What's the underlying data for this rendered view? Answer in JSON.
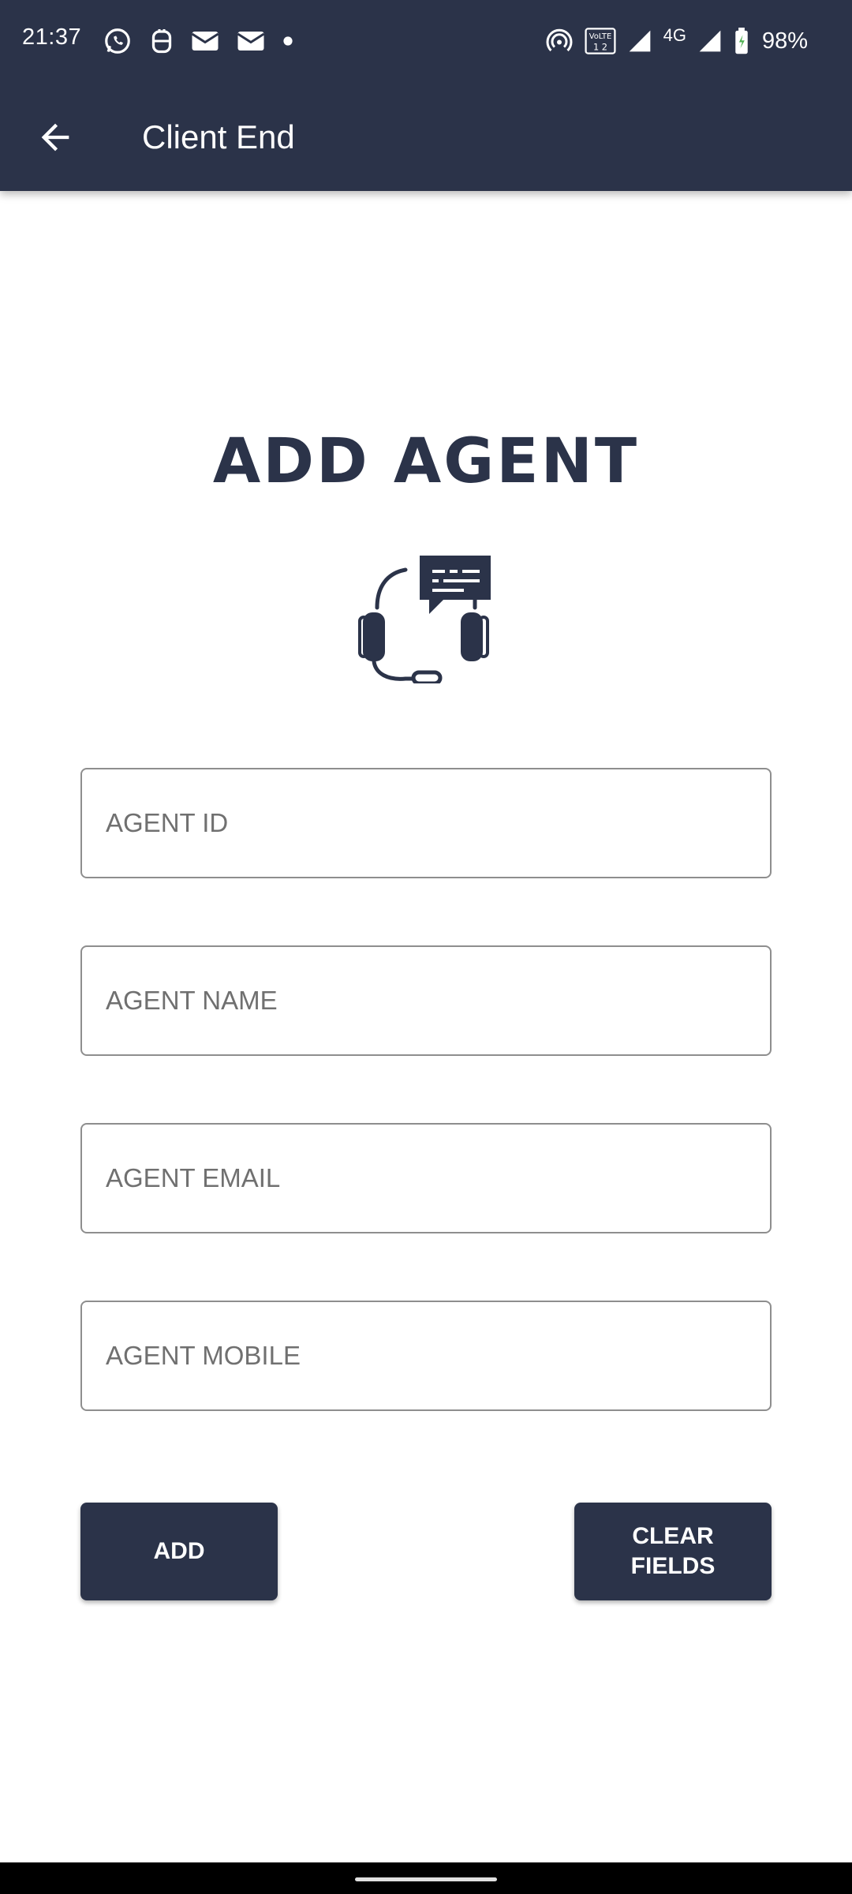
{
  "status_bar": {
    "time": "21:37",
    "battery": "98%",
    "network": "4G",
    "left_icons": [
      "whatsapp-icon",
      "notification-app-icon",
      "gmail-icon",
      "gmail-icon",
      "dot-icon"
    ],
    "right_icons": [
      "hotspot-icon",
      "volte-icon",
      "signal-icon",
      "signal-icon",
      "battery-icon"
    ]
  },
  "app_bar": {
    "title": "Client End",
    "back_icon": "arrow-left-icon"
  },
  "page": {
    "heading": "ADD AGENT",
    "hero_icon": "headset-chat-icon"
  },
  "form": {
    "agent_id": {
      "placeholder": "AGENT ID",
      "value": ""
    },
    "agent_name": {
      "placeholder": "AGENT NAME",
      "value": ""
    },
    "agent_email": {
      "placeholder": "AGENT EMAIL",
      "value": ""
    },
    "agent_mobile": {
      "placeholder": "AGENT MOBILE",
      "value": ""
    }
  },
  "actions": {
    "add_label": "ADD",
    "clear_label_line1": "CLEAR",
    "clear_label_line2": "FIELDS"
  },
  "colors": {
    "primary": "#2b3349",
    "background": "#ffffff",
    "field_border": "#8e8e8e"
  }
}
